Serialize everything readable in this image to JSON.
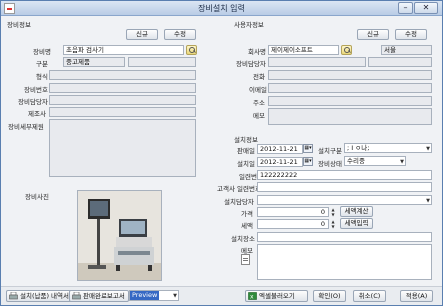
{
  "window": {
    "title": "장비설치 입력"
  },
  "left": {
    "section": "장비정보",
    "new_btn": "신규",
    "edit_btn": "수정",
    "labels": {
      "name": "장비명",
      "kind": "구분",
      "model": "형식",
      "number": "장비번호",
      "owner": "장비담당자",
      "maker": "제조사",
      "detail": "장비세부제원",
      "photo": "장비사진"
    },
    "values": {
      "name": "초음파 검사기",
      "kind": "중고제품"
    }
  },
  "right": {
    "section": "사용자정보",
    "new_btn": "신규",
    "edit_btn": "수정",
    "labels": {
      "company": "회사명",
      "owner": "장비담당자",
      "phone": "전화",
      "email": "이메일",
      "address": "주소",
      "memo": "메모"
    },
    "values": {
      "company": "제이제이소프트",
      "region": "서울"
    }
  },
  "install": {
    "section": "설치정보",
    "labels": {
      "sale_date": "판매일",
      "install_kind": "설치구분",
      "install_date": "설치일",
      "status": "장비상태",
      "serial": "일련번호",
      "client_serial": "고객사 일련번호",
      "installer": "설치담당자",
      "price": "가격",
      "tax": "세액",
      "place": "설치장소",
      "memo": "메모"
    },
    "values": {
      "sale_date": "2012-11-21",
      "install_kind": "; I ㅇ나;",
      "install_date": "2012-11-21",
      "status": "수리중",
      "serial": "122222222",
      "price": "0",
      "tax": "0"
    },
    "tax_calc_btn": "세액계산",
    "tax_input_btn": "세액입력"
  },
  "footer": {
    "report_btn": "설치(납품) 내역서",
    "done_btn": "판매완료보고서",
    "preview": "Preview",
    "excel_btn": "엑셀불러오기",
    "ok_btn": "확인(O)",
    "cancel_btn": "취소(C)",
    "apply_btn": "적용(A)"
  }
}
